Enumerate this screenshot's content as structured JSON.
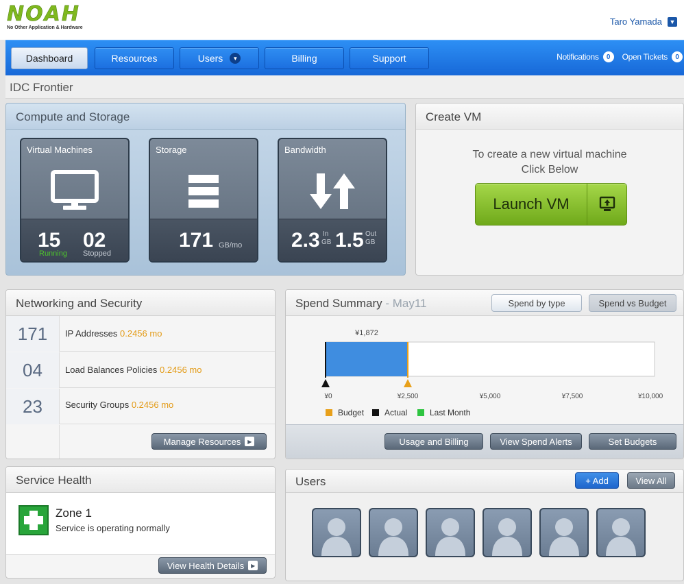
{
  "brand": {
    "logo": "NOAH",
    "tagline": "No Other Application & Hardware"
  },
  "user": {
    "name": "Taro Yamada",
    "caret_icon": "chevron-down-icon"
  },
  "nav": {
    "items": [
      {
        "label": "Dashboard",
        "active": true
      },
      {
        "label": "Resources"
      },
      {
        "label": "Users",
        "has_dropdown": true
      },
      {
        "label": "Billing"
      },
      {
        "label": "Support"
      }
    ],
    "notifications_label": "Notifications",
    "notifications_count": "0",
    "tickets_label": "Open Tickets",
    "tickets_count": "0"
  },
  "site": {
    "title": "IDC Frontier"
  },
  "compute": {
    "title": "Compute and Storage",
    "vm": {
      "label": "Virtual Machines",
      "running": "15",
      "running_label": "Running",
      "stopped": "02",
      "stopped_label": "Stopped"
    },
    "storage": {
      "label": "Storage",
      "value": "171",
      "unit": "GB/mo"
    },
    "bandwidth": {
      "label": "Bandwidth",
      "in_value": "2.3",
      "in_label": "In",
      "in_unit": "GB",
      "out_value": "1.5",
      "out_label": "Out",
      "out_unit": "GB"
    }
  },
  "create_vm": {
    "title": "Create VM",
    "line1": "To create a new virtual machine",
    "line2": "Click Below",
    "button": "Launch VM"
  },
  "networking": {
    "title": "Networking and Security",
    "rows": [
      {
        "count": "171",
        "label": "IP Addresses",
        "price": "0.2456 mo"
      },
      {
        "count": "04",
        "label": "Load Balances Policies",
        "price": "0.2456 mo"
      },
      {
        "count": "23",
        "label": "Security Groups",
        "price": "0.2456 mo"
      }
    ],
    "manage_button": "Manage Resources"
  },
  "spend": {
    "title": "Spend Summary",
    "period": "- May11",
    "toggle_type": "Spend by type",
    "toggle_budget": "Spend vs Budget",
    "buttons": {
      "usage": "Usage and Billing",
      "alerts": "View Spend Alerts",
      "budgets": "Set Budgets"
    }
  },
  "chart_data": {
    "type": "bar",
    "orientation": "horizontal",
    "value_label": "¥1,872",
    "actual": 1872,
    "budget": 2500,
    "xlim": [
      0,
      10000
    ],
    "ticks": [
      "¥0",
      "¥2,500",
      "¥5,000",
      "¥7,500",
      "¥10,000"
    ],
    "tick_values": [
      0,
      2500,
      5000,
      7500,
      10000
    ],
    "legend": [
      {
        "name": "Budget",
        "color": "#e8a01a"
      },
      {
        "name": "Actual",
        "color": "#111111"
      },
      {
        "name": "Last Month",
        "color": "#2ec440"
      }
    ],
    "bar_color": "#3f8de0"
  },
  "health": {
    "title": "Service Health",
    "zone": "Zone 1",
    "status": "Service is operating normally",
    "button": "View Health Details"
  },
  "users": {
    "title": "Users",
    "add_button": "+ Add",
    "view_all_button": "View All",
    "avatar_count": 6
  }
}
